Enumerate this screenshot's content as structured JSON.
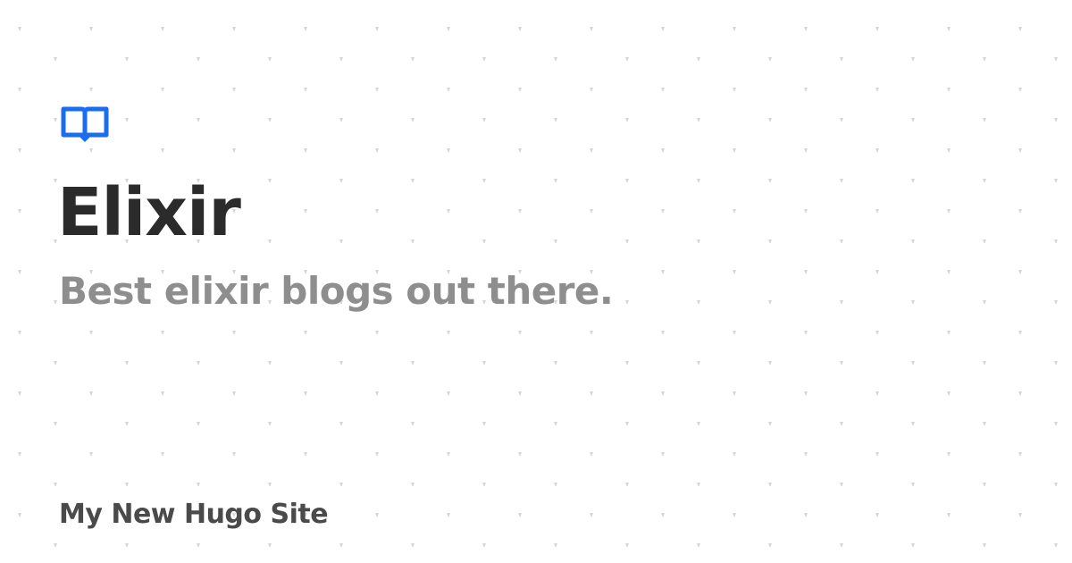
{
  "colors": {
    "background": "#ffffff",
    "pattern_dot": "#d6d6d6",
    "accent": "#1a6cf0",
    "title": "#2b2b2b",
    "subtitle": "#8e8e8e",
    "site_name": "#4a4a4a"
  },
  "logo": {
    "icon": "open-book-icon"
  },
  "title": "Elixir",
  "subtitle": "Best elixir blogs out there.",
  "site_name": "My New Hugo Site"
}
